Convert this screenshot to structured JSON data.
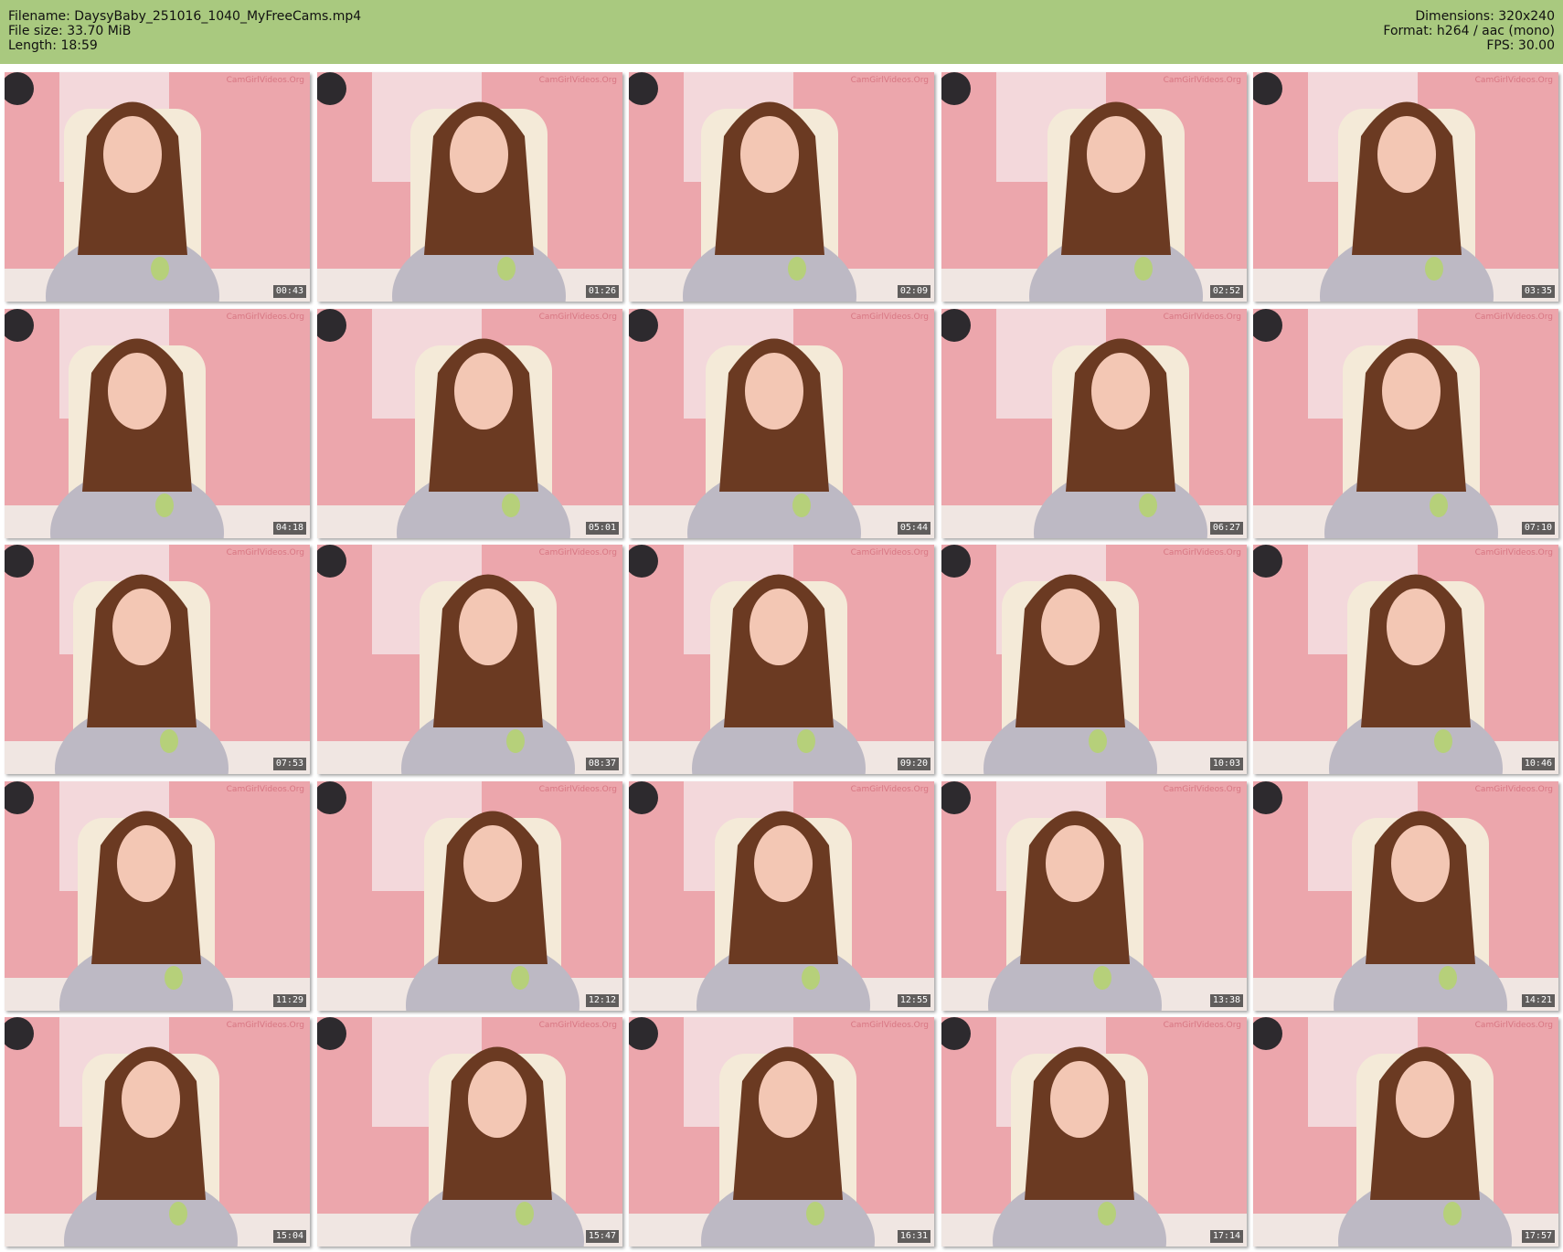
{
  "header": {
    "filename": "Filename: DaysyBaby_251016_1040_MyFreeCams.mp4",
    "filesize": "File size: 33.70 MiB",
    "length": "Length: 18:59",
    "dimensions": "Dimensions: 320x240",
    "format": "Format: h264 / aac (mono)",
    "fps": "FPS: 30.00"
  },
  "colors": {
    "header_bg": "#a9c97f",
    "wall": "#eca6ac",
    "chair": "#f4ead8",
    "shirt": "#bdb9c4",
    "hair": "#6b3a22"
  },
  "watermark": "CamGirlVideos.Org",
  "thumbnails": [
    {
      "time": "00:43"
    },
    {
      "time": "01:26"
    },
    {
      "time": "02:09"
    },
    {
      "time": "02:52"
    },
    {
      "time": "03:35"
    },
    {
      "time": "04:18"
    },
    {
      "time": "05:01"
    },
    {
      "time": "05:44"
    },
    {
      "time": "06:27"
    },
    {
      "time": "07:10"
    },
    {
      "time": "07:53"
    },
    {
      "time": "08:37"
    },
    {
      "time": "09:20"
    },
    {
      "time": "10:03"
    },
    {
      "time": "10:46"
    },
    {
      "time": "11:29"
    },
    {
      "time": "12:12"
    },
    {
      "time": "12:55"
    },
    {
      "time": "13:38"
    },
    {
      "time": "14:21"
    },
    {
      "time": "15:04"
    },
    {
      "time": "15:47"
    },
    {
      "time": "16:31"
    },
    {
      "time": "17:14"
    },
    {
      "time": "17:57"
    }
  ]
}
